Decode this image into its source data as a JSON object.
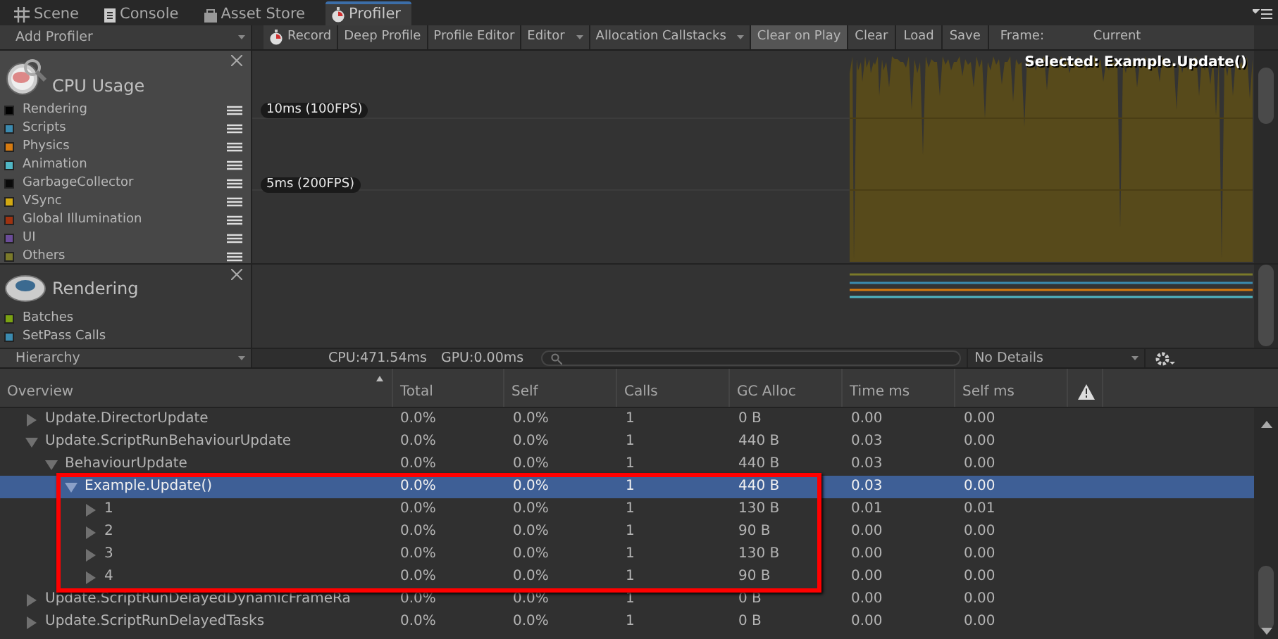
{
  "tabs": [
    {
      "label": "Scene",
      "kind": "grid",
      "selected": false
    },
    {
      "label": "Console",
      "kind": "console",
      "selected": false
    },
    {
      "label": "Asset Store",
      "kind": "store",
      "selected": false
    },
    {
      "label": "Profiler",
      "kind": "profiler",
      "selected": true
    }
  ],
  "toolbar": {
    "add_profiler": "Add Profiler",
    "buttons": [
      {
        "label": "Record",
        "kind": "record",
        "on": false
      },
      {
        "label": "Deep Profile",
        "kind": "toggle",
        "on": false
      },
      {
        "label": "Profile Editor",
        "kind": "toggle",
        "on": false
      },
      {
        "label": "Editor",
        "kind": "dropdown"
      },
      {
        "label": "Allocation Callstacks",
        "kind": "dropdown"
      },
      {
        "label": "Clear on Play",
        "kind": "toggle",
        "on": true
      },
      {
        "label": "Clear",
        "kind": "button"
      },
      {
        "label": "Load",
        "kind": "button"
      },
      {
        "label": "Save",
        "kind": "button"
      }
    ],
    "frame_label": "Frame:",
    "frame_value": "Current"
  },
  "profilers": [
    {
      "title": "CPU Usage",
      "kind": "cpu",
      "legend": [
        {
          "label": "Rendering",
          "color": "#000000"
        },
        {
          "label": "Scripts",
          "color": "#3b8bb0"
        },
        {
          "label": "Physics",
          "color": "#d67b11"
        },
        {
          "label": "Animation",
          "color": "#50b6c4"
        },
        {
          "label": "GarbageCollector",
          "color": "#0a0a0a"
        },
        {
          "label": "VSync",
          "color": "#d2a912"
        },
        {
          "label": "Global Illumination",
          "color": "#9e3210"
        },
        {
          "label": "UI",
          "color": "#6b4c99"
        },
        {
          "label": "Others",
          "color": "#7b7a2a"
        }
      ],
      "graph_labels": [
        "10ms (100FPS)",
        "5ms (200FPS)"
      ],
      "selected_label": "Selected: Example.Update()"
    },
    {
      "title": "Rendering",
      "kind": "rendering",
      "legend": [
        {
          "label": "Batches",
          "color": "#7ba312"
        },
        {
          "label": "SetPass Calls",
          "color": "#3b8bb0"
        }
      ]
    }
  ],
  "details_bar": {
    "view": "Hierarchy",
    "cpu": "CPU:471.54ms",
    "gpu": "GPU:0.00ms",
    "details": "No Details"
  },
  "table": {
    "header": {
      "overview": "Overview",
      "stats": [
        "Total",
        "Self",
        "Calls",
        "GC Alloc",
        "Time ms",
        "Self ms"
      ]
    },
    "rows": [
      {
        "name": "Update.DirectorUpdate",
        "expanded": false,
        "selected": false,
        "cells": [
          "0.0%",
          "0.0%",
          "1",
          "0 B",
          "0.00",
          "0.00"
        ]
      },
      {
        "name": "Update.ScriptRunBehaviourUpdate",
        "expanded": true,
        "selected": false,
        "cells": [
          "0.0%",
          "0.0%",
          "1",
          "440 B",
          "0.03",
          "0.00"
        ],
        "children": [
          {
            "name": "BehaviourUpdate",
            "expanded": true,
            "selected": false,
            "cells": [
              "0.0%",
              "0.0%",
              "1",
              "440 B",
              "0.03",
              "0.00"
            ],
            "children": [
              {
                "name": "Example.Update()",
                "expanded": true,
                "selected": true,
                "cells": [
                  "0.0%",
                  "0.0%",
                  "1",
                  "440 B",
                  "0.03",
                  "0.00"
                ],
                "children": [
                  {
                    "name": "1",
                    "expanded": false,
                    "selected": false,
                    "cells": [
                      "0.0%",
                      "0.0%",
                      "1",
                      "130 B",
                      "0.01",
                      "0.01"
                    ]
                  },
                  {
                    "name": "2",
                    "expanded": false,
                    "selected": false,
                    "cells": [
                      "0.0%",
                      "0.0%",
                      "1",
                      "90 B",
                      "0.00",
                      "0.00"
                    ]
                  },
                  {
                    "name": "3",
                    "expanded": false,
                    "selected": false,
                    "cells": [
                      "0.0%",
                      "0.0%",
                      "1",
                      "130 B",
                      "0.00",
                      "0.00"
                    ]
                  },
                  {
                    "name": "4",
                    "expanded": false,
                    "selected": false,
                    "cells": [
                      "0.0%",
                      "0.0%",
                      "1",
                      "90 B",
                      "0.00",
                      "0.00"
                    ]
                  }
                ]
              }
            ]
          }
        ]
      },
      {
        "name": "Update.ScriptRunDelayedDynamicFrameRa",
        "expanded": false,
        "selected": false,
        "cells": [
          "0.0%",
          "0.0%",
          "1",
          "0 B",
          "0.00",
          "0.00"
        ]
      },
      {
        "name": "Update.ScriptRunDelayedTasks",
        "expanded": false,
        "selected": false,
        "cells": [
          "0.0%",
          "0.0%",
          "1",
          "0 B",
          "0.00",
          "0.00"
        ]
      }
    ]
  }
}
